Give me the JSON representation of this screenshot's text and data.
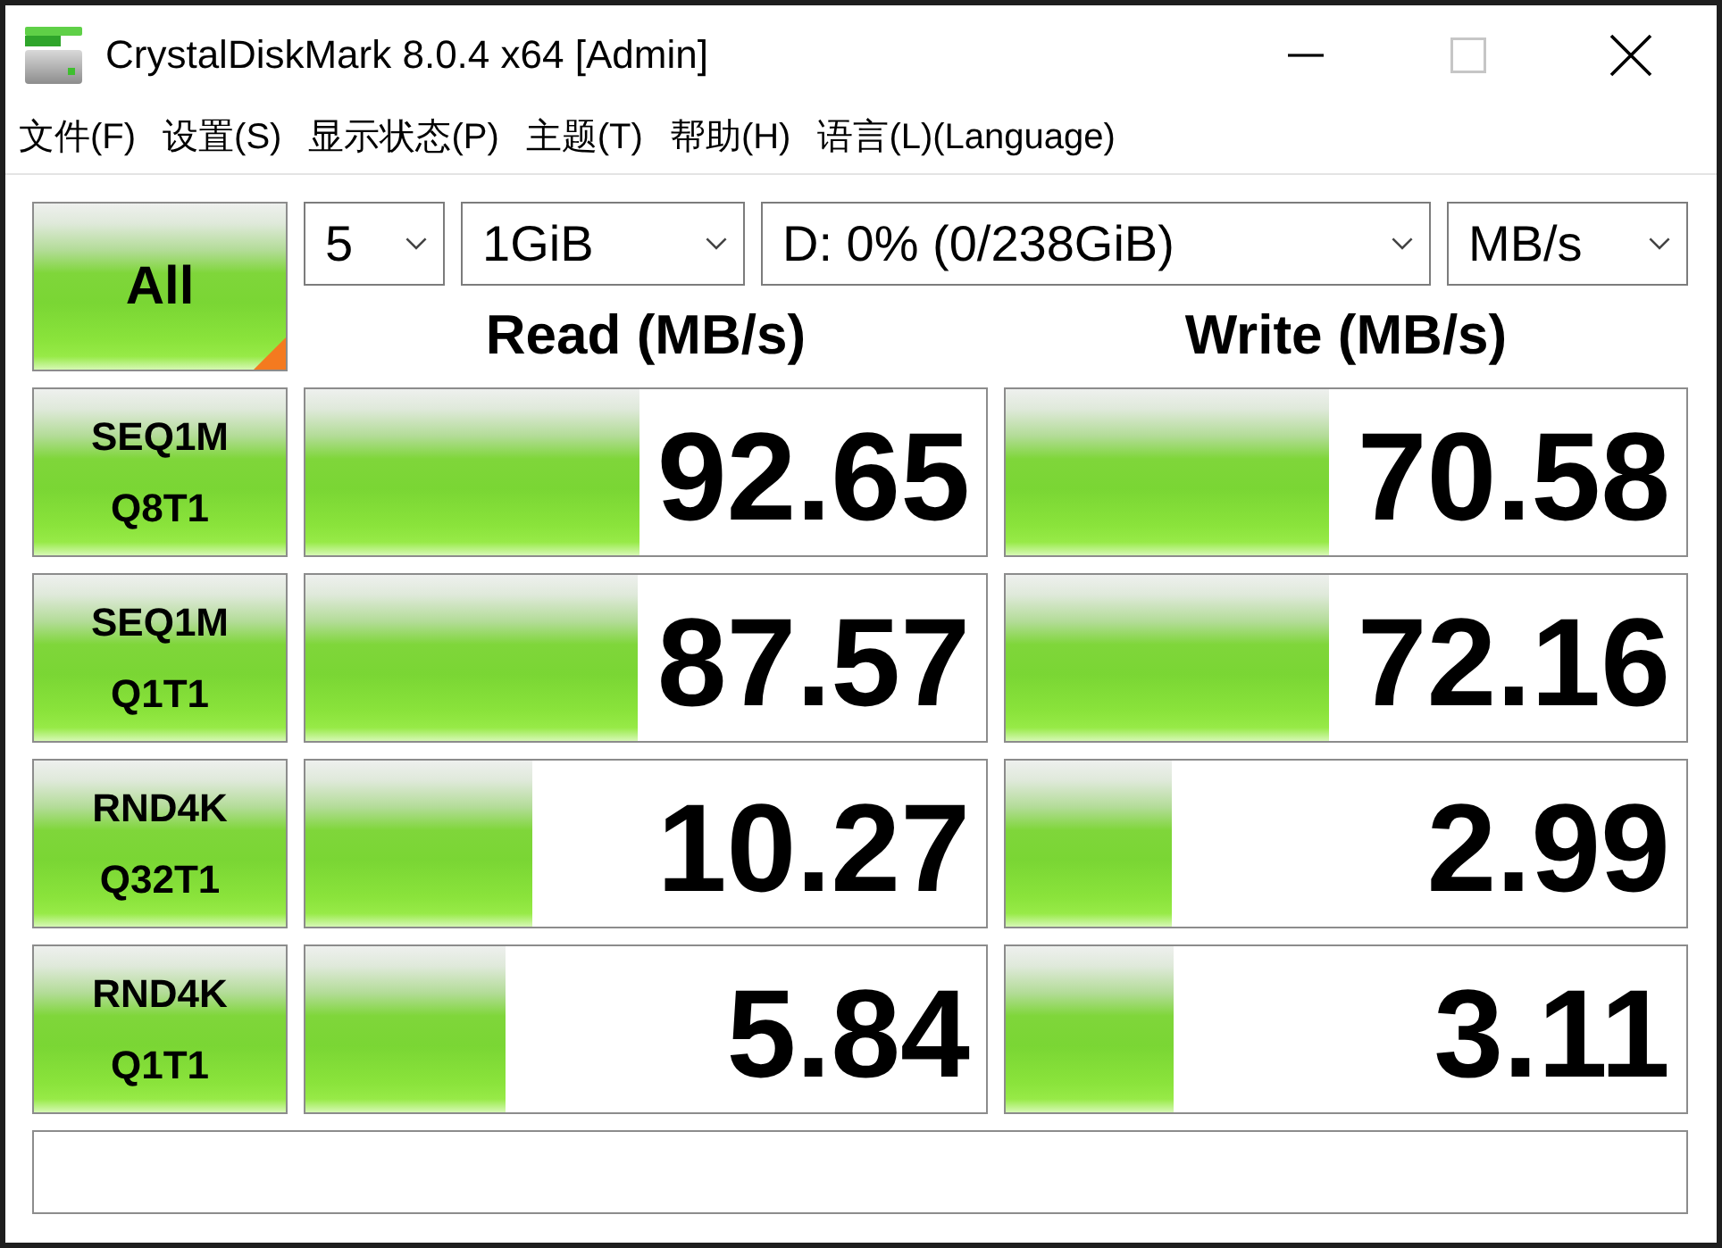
{
  "window": {
    "title": "CrystalDiskMark 8.0.4 x64 [Admin]",
    "buttons": [
      {
        "kind": "minimize",
        "disabled": false
      },
      {
        "kind": "maximize",
        "disabled": true
      },
      {
        "kind": "close",
        "disabled": false
      }
    ]
  },
  "menu": [
    "文件(F)",
    "设置(S)",
    "显示状态(P)",
    "主题(T)",
    "帮助(H)",
    "语言(L)(Language)"
  ],
  "all_button": {
    "label": "All"
  },
  "selectors": {
    "runs": "5",
    "size": "1GiB",
    "drive": "D: 0% (0/238GiB)",
    "unit": "MB/s"
  },
  "headers": [
    "Read (MB/s)",
    "Write (MB/s)"
  ],
  "tests": [
    {
      "label": [
        "SEQ1M",
        "Q8T1"
      ],
      "read": {
        "value": "92.65",
        "level": 0.49
      },
      "write": {
        "value": "70.58",
        "level": 0.475
      }
    },
    {
      "label": [
        "SEQ1M",
        "Q1T1"
      ],
      "read": {
        "value": "87.57",
        "level": 0.487
      },
      "write": {
        "value": "72.16",
        "level": 0.475
      }
    },
    {
      "label": [
        "RND4K",
        "Q32T1"
      ],
      "read": {
        "value": "10.27",
        "level": 0.333
      },
      "write": {
        "value": "2.99",
        "level": 0.244
      }
    },
    {
      "label": [
        "RND4K",
        "Q1T1"
      ],
      "read": {
        "value": "5.84",
        "level": 0.294
      },
      "write": {
        "value": "3.11",
        "level": 0.247
      }
    }
  ]
}
